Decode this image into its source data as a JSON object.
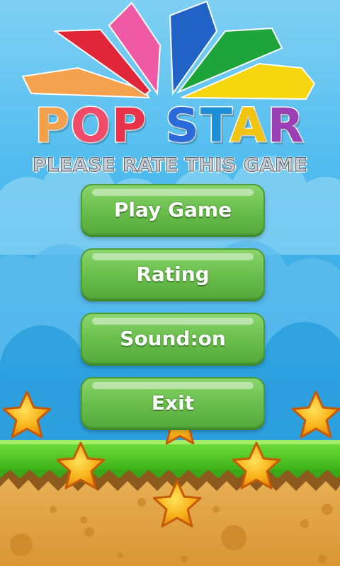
{
  "game": {
    "title_letters": [
      "P",
      "O",
      "P",
      " ",
      "S",
      "T",
      "A",
      "R"
    ],
    "title_colors": [
      "#f2a04a",
      "#f04b6b",
      "#e8334a",
      "",
      "#2b6bd9",
      "#1d8fd8",
      "#f1c40f",
      "#9b3fb5"
    ],
    "subtitle": "PLEASE RATE THIS GAME"
  },
  "menu": {
    "play": "Play Game",
    "rating": "Rating",
    "sound": "Sound:on",
    "exit": "Exit"
  },
  "colors": {
    "sky": "#2fa9e6",
    "grass": "#49c624",
    "dirt": "#e3a84b",
    "button": "#6cc04e",
    "star": "#f6b21a"
  },
  "logo_petals": [
    "orange",
    "red",
    "pink",
    "blue",
    "green",
    "yellow"
  ]
}
